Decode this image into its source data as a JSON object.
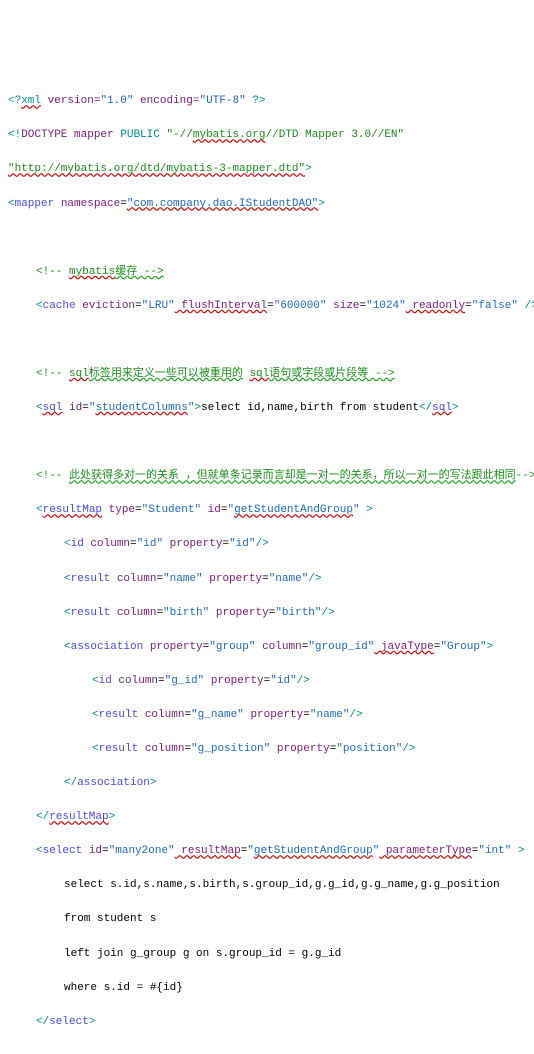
{
  "lines": {
    "l1_a": "<?",
    "l1_b": "xml",
    "l1_c": " version=",
    "l1_d": "\"1.0\"",
    "l1_e": " encoding=",
    "l1_f": "\"UTF-8\"",
    "l1_g": " ?>",
    "l2_a": "<!",
    "l2_b": "DOCTYPE",
    "l2_c": " mapper",
    "l2_d": " PUBLIC",
    "l2_e": " \"-//",
    "l2_f": "mybatis.org",
    "l2_g": "//DTD Mapper 3.0//EN\"",
    "l3": "\"http://mybatis.org/dtd/mybatis-3-mapper.dtd\"",
    "l3_end": ">",
    "l4_a": "<",
    "l4_b": "mapper",
    "l4_c": " namespace",
    "l4_d": "=",
    "l4_e": "\"com.company.dao.IStudentDAO\"",
    "l4_f": ">",
    "c1_a": "<!-- ",
    "c1_b": "mybatis",
    "c1_c": "缓存 -->",
    "l5_a": "<",
    "l5_b": "cache",
    "l5_c": " eviction",
    "l5_d": "=",
    "l5_e": "\"LRU\"",
    "l5_f": " flushInterval",
    "l5_g": "=",
    "l5_h": "\"600000\"",
    "l5_i": " size",
    "l5_j": "=",
    "l5_k": "\"1024\"",
    "l5_l": " readonly",
    "l5_m": "=",
    "l5_n": "\"false\"",
    "l5_o": " />",
    "c2_a": "<!-- ",
    "c2_b": "sql",
    "c2_c": "标签用来定义一些可以被重用的",
    "c2_d_sp": " ",
    "c2_d": "sql",
    "c2_e": "语句或字段或片段等 -->",
    "l6_a": "<",
    "l6_b": "sql",
    "l6_c": " id",
    "l6_d": "=",
    "l6_e": "\"",
    "l6_f": "studentColumns",
    "l6_g": "\"",
    "l6_h": ">",
    "l6_txt": "select id,name,birth from student",
    "l6_i": "</",
    "l6_j": "sql",
    "l6_k": ">",
    "c3_a": "<!-- ",
    "c3_b": "此处获得多对一的关系 ，但就单条记录而言却是一对一的关系，所以一对一的写法跟此相同",
    "c3_c": "-->",
    "l7_a": "<",
    "l7_b": "resultMap",
    "l7_c": " type",
    "l7_d": "=",
    "l7_e": "\"Student\"",
    "l7_f": " id",
    "l7_g": "=",
    "l7_h": "\"",
    "l7_i": "getStudentAndGroup",
    "l7_j": "\" ",
    "l7_k": ">",
    "l8_a": "<",
    "l8_b": "id",
    "l8_c": " column",
    "l8_d": "=",
    "l8_e": "\"id\"",
    "l8_f": " property",
    "l8_g": "=",
    "l8_h": "\"id\"",
    "l8_i": "/>",
    "l9_a": "<",
    "l9_b": "result",
    "l9_c": " column",
    "l9_d": "=",
    "l9_e": "\"name\"",
    "l9_f": " property",
    "l9_g": "=",
    "l9_h": "\"name\"",
    "l9_i": "/>",
    "l10_a": "<",
    "l10_b": "result",
    "l10_c": " column",
    "l10_d": "=",
    "l10_e": "\"birth\"",
    "l10_f": " property",
    "l10_g": "=",
    "l10_h": "\"birth\"",
    "l10_i": "/>",
    "l11_a": "<",
    "l11_b": "association",
    "l11_c": " property",
    "l11_d": "=",
    "l11_e": "\"group\"",
    "l11_f": " column",
    "l11_g": "=",
    "l11_h": "\"group_id\"",
    "l11_i": " javaType",
    "l11_j": "=",
    "l11_k": "\"Group\"",
    "l11_l": ">",
    "l12_a": "<",
    "l12_b": "id",
    "l12_c": " column",
    "l12_d": "=",
    "l12_e": "\"g_id\"",
    "l12_f": " property",
    "l12_g": "=",
    "l12_h": "\"id\"",
    "l12_i": "/>",
    "l13_a": "<",
    "l13_b": "result",
    "l13_c": " column",
    "l13_d": "=",
    "l13_e": "\"g_name\"",
    "l13_f": " property",
    "l13_g": "=",
    "l13_h": "\"name\"",
    "l13_i": "/>",
    "l14_a": "<",
    "l14_b": "result",
    "l14_c": " column",
    "l14_d": "=",
    "l14_e": "\"g_position\"",
    "l14_f": " property",
    "l14_g": "=",
    "l14_h": "\"position\"",
    "l14_i": "/>",
    "l15_a": "</",
    "l15_b": "association",
    "l15_c": ">",
    "l16_a": "</",
    "l16_b": "resultMap",
    "l16_c": ">",
    "l17_a": "<",
    "l17_b": "select",
    "l17_c": " id",
    "l17_d": "=",
    "l17_e": "\"many2one\"",
    "l17_f": " resultMap",
    "l17_g": "=",
    "l17_h": "\"",
    "l17_i": "getStudentAndGroup",
    "l17_j": "\"",
    "l17_k": " parameterType",
    "l17_l": "=",
    "l17_m": "\"int\" ",
    "l17_n": ">",
    "l18": "select s.id,s.name,s.birth,s.group_id,g.g_id,g.g_name,g.g_position",
    "l19": "from student s",
    "l20": "left join g_group g on s.group_id = g.g_id",
    "l21": "where s.id = #{id}",
    "l22_a": "</",
    "l22_b": "select",
    "l22_c": ">"
  }
}
